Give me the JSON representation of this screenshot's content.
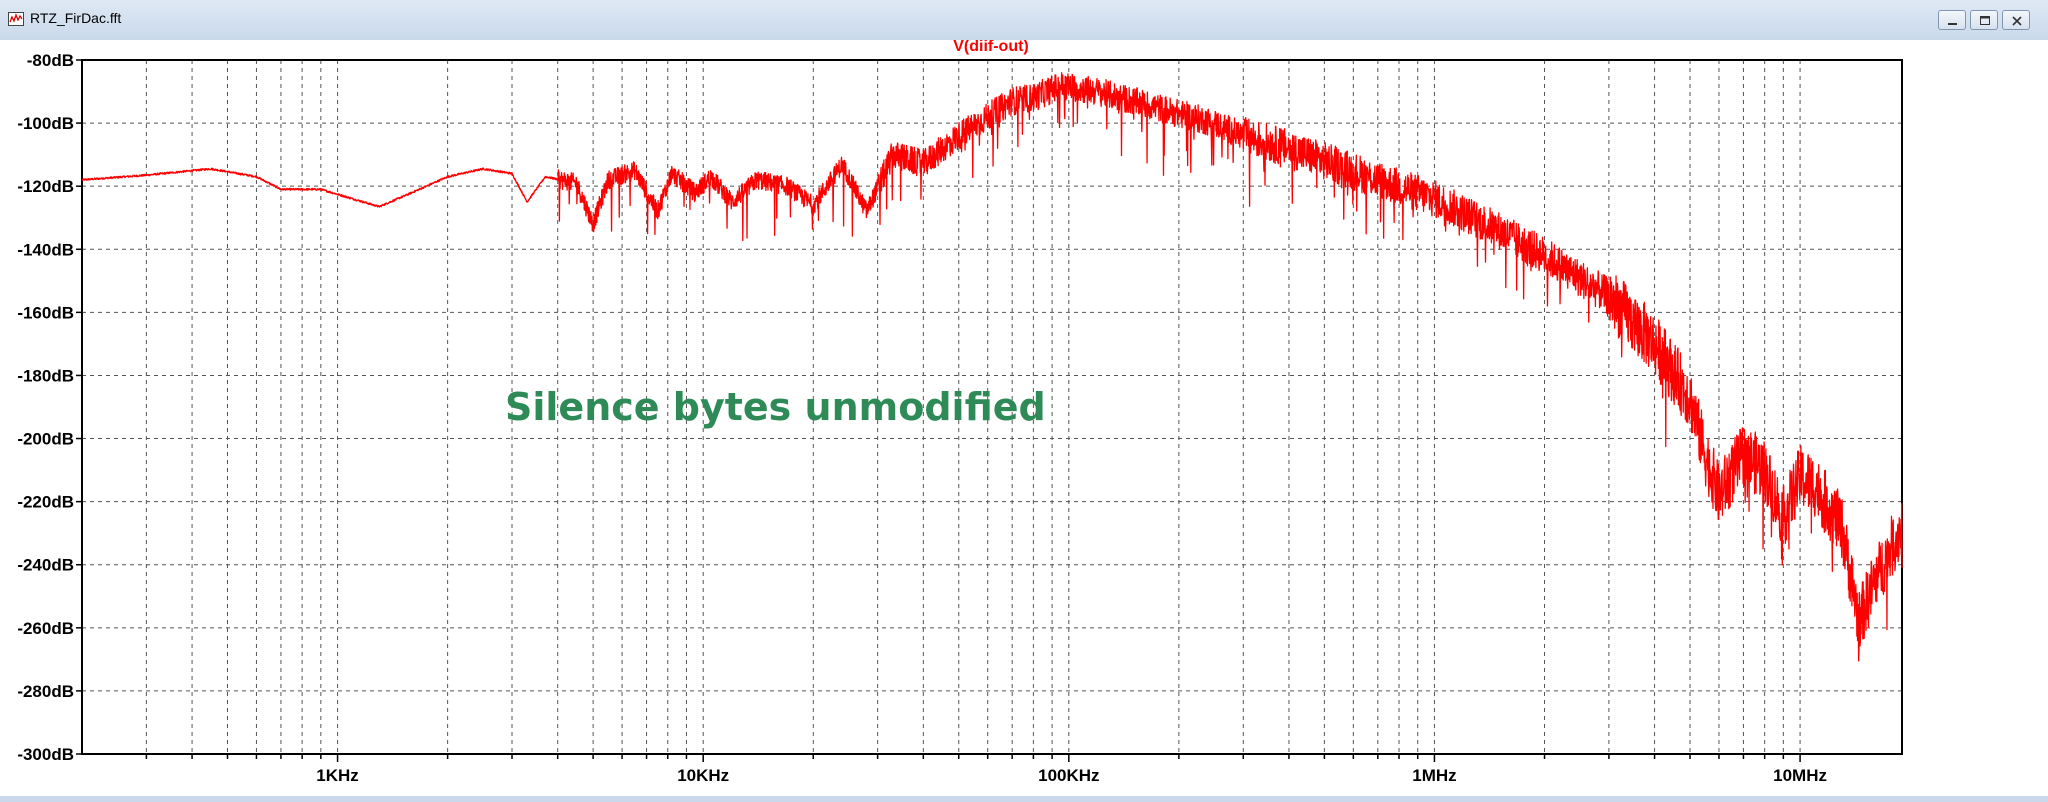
{
  "window": {
    "title": "RTZ_FirDac.fft",
    "app_icon": "waveform-icon",
    "controls": [
      "minimize-icon",
      "maximize-icon",
      "close-icon"
    ]
  },
  "chart_data": {
    "type": "line",
    "title": "V(diif-out)",
    "annotation": "Silence bytes unmodified",
    "x_scale": "log",
    "xlim": [
      200,
      19000000
    ],
    "ylim": [
      -300,
      -80
    ],
    "x_ticks": [
      {
        "value": 1000,
        "label": "1KHz"
      },
      {
        "value": 10000,
        "label": "10KHz"
      },
      {
        "value": 100000,
        "label": "100KHz"
      },
      {
        "value": 1000000,
        "label": "1MHz"
      },
      {
        "value": 10000000,
        "label": "10MHz"
      }
    ],
    "y_ticks": [
      {
        "value": -80,
        "label": "-80dB"
      },
      {
        "value": -100,
        "label": "-100dB"
      },
      {
        "value": -120,
        "label": "-120dB"
      },
      {
        "value": -140,
        "label": "-140dB"
      },
      {
        "value": -160,
        "label": "-160dB"
      },
      {
        "value": -180,
        "label": "-180dB"
      },
      {
        "value": -200,
        "label": "-200dB"
      },
      {
        "value": -220,
        "label": "-220dB"
      },
      {
        "value": -240,
        "label": "-240dB"
      },
      {
        "value": -260,
        "label": "-260dB"
      },
      {
        "value": -280,
        "label": "-280dB"
      },
      {
        "value": -300,
        "label": "-300dB"
      }
    ],
    "grid": true,
    "colors": {
      "trace": "#ff0000",
      "title": "#ff0000",
      "annotation": "#2e8b57",
      "grid": "#555555",
      "axis": "#000000"
    },
    "series": [
      {
        "name": "V(diif-out)",
        "points": [
          [
            200,
            -118
          ],
          [
            300,
            -116.5
          ],
          [
            450,
            -114.5
          ],
          [
            600,
            -117
          ],
          [
            700,
            -121
          ],
          [
            900,
            -121
          ],
          [
            1100,
            -124
          ],
          [
            1300,
            -126.5
          ],
          [
            1600,
            -122
          ],
          [
            2000,
            -117
          ],
          [
            2500,
            -114.5
          ],
          [
            3000,
            -116
          ],
          [
            3300,
            -125
          ],
          [
            3700,
            -117
          ],
          [
            4500,
            -119
          ],
          [
            5000,
            -132
          ],
          [
            5500,
            -118
          ],
          [
            6500,
            -115
          ],
          [
            7500,
            -128
          ],
          [
            8200,
            -116
          ],
          [
            9500,
            -122
          ],
          [
            10500,
            -117
          ],
          [
            12000,
            -125
          ],
          [
            14000,
            -118
          ],
          [
            17000,
            -120
          ],
          [
            20000,
            -126
          ],
          [
            24000,
            -113
          ],
          [
            28000,
            -128
          ],
          [
            33000,
            -110
          ],
          [
            40000,
            -113
          ],
          [
            50000,
            -104
          ],
          [
            60000,
            -98
          ],
          [
            70000,
            -93
          ],
          [
            80000,
            -92
          ],
          [
            95000,
            -88
          ],
          [
            120000,
            -90
          ],
          [
            150000,
            -93
          ],
          [
            200000,
            -97
          ],
          [
            250000,
            -100
          ],
          [
            300000,
            -104
          ],
          [
            400000,
            -108
          ],
          [
            500000,
            -112
          ],
          [
            700000,
            -118
          ],
          [
            1000000,
            -124
          ],
          [
            1500000,
            -134
          ],
          [
            2000000,
            -142
          ],
          [
            3000000,
            -155
          ],
          [
            4000000,
            -170
          ],
          [
            5000000,
            -187
          ],
          [
            5500000,
            -205
          ],
          [
            6000000,
            -218
          ],
          [
            7000000,
            -205
          ],
          [
            8000000,
            -210
          ],
          [
            9000000,
            -225
          ],
          [
            10000000,
            -212
          ],
          [
            11000000,
            -215
          ],
          [
            13000000,
            -228
          ],
          [
            14500000,
            -258
          ],
          [
            16000000,
            -245
          ],
          [
            19000000,
            -228
          ]
        ]
      }
    ]
  }
}
